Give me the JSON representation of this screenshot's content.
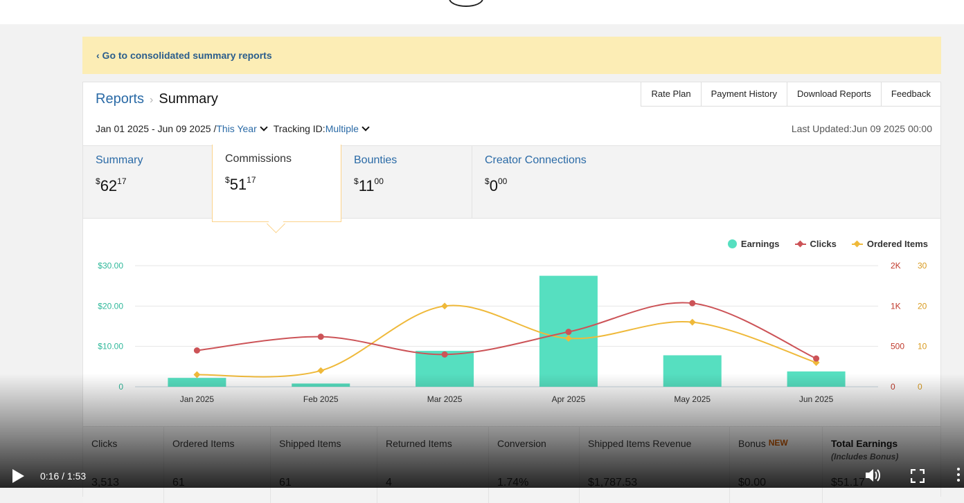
{
  "banner": {
    "link": "‹ Go to consolidated summary reports"
  },
  "breadcrumb": {
    "parent": "Reports",
    "separator": "›",
    "current": "Summary"
  },
  "toolbar": {
    "items": [
      "Rate Plan",
      "Payment History",
      "Download Reports",
      "Feedback"
    ]
  },
  "filters": {
    "date_range": "Jan 01 2025 - Jun 09 2025 /",
    "period": "This Year",
    "tracking_label": "Tracking ID:",
    "tracking_value": "Multiple",
    "last_updated": "Last Updated:Jun 09 2025 00:00"
  },
  "tabs": [
    {
      "label": "Summary",
      "currency": "$",
      "whole": "62",
      "cents": "17",
      "active": false
    },
    {
      "label": "Commissions",
      "currency": "$",
      "whole": "51",
      "cents": "17",
      "active": true
    },
    {
      "label": "Bounties",
      "currency": "$",
      "whole": "11",
      "cents": "00",
      "active": false
    },
    {
      "label": "Creator Connections",
      "currency": "$",
      "whole": "0",
      "cents": "00",
      "active": false
    }
  ],
  "legend": [
    "Earnings",
    "Clicks",
    "Ordered Items"
  ],
  "colors": {
    "earnings": "#56dfc0",
    "clicks": "#cc5357",
    "ordered": "#efb93a",
    "earnings_axis": "#2fb89a",
    "clicks_axis": "#c0392b",
    "ordered_axis": "#d89a1e"
  },
  "chart_data": {
    "type": "bar",
    "categories": [
      "Jan 2025",
      "Feb 2025",
      "Mar 2025",
      "Apr 2025",
      "May 2025",
      "Jun 2025"
    ],
    "series": [
      {
        "name": "Earnings",
        "type": "bar",
        "axis": "left",
        "values": [
          2.2,
          0.8,
          8.9,
          27.5,
          7.8,
          3.8
        ]
      },
      {
        "name": "Clicks",
        "type": "line",
        "axis": "right1",
        "values": [
          450,
          620,
          400,
          680,
          1070,
          350
        ]
      },
      {
        "name": "Ordered Items",
        "type": "line",
        "axis": "right2",
        "values": [
          3,
          4,
          20,
          12,
          16,
          6
        ]
      }
    ],
    "axes": {
      "left": {
        "ticks": [
          "0",
          "$10.00",
          "$20.00",
          "$30.00"
        ],
        "ylim": [
          0,
          30
        ]
      },
      "right1": {
        "ticks": [
          "0",
          "500",
          "1K",
          "2K"
        ],
        "tick_values": [
          0,
          500,
          1000,
          2000
        ]
      },
      "right2": {
        "ticks": [
          "0",
          "10",
          "20",
          "30"
        ],
        "ylim": [
          0,
          30
        ]
      }
    },
    "grid": true,
    "legend_position": "top-right"
  },
  "stats": [
    {
      "label": "Clicks",
      "value": "3,513"
    },
    {
      "label": "Ordered Items",
      "value": "61"
    },
    {
      "label": "Shipped Items",
      "value": "61"
    },
    {
      "label": "Returned Items",
      "value": "4"
    },
    {
      "label": "Conversion",
      "value": "1.74%"
    },
    {
      "label": "Shipped Items Revenue",
      "value": "$1,787.53"
    },
    {
      "label": "Bonus",
      "badge": "NEW",
      "value": "$0.00"
    },
    {
      "label": "Total Earnings",
      "sublabel": "(Includes Bonus)",
      "value": "$51.17"
    }
  ],
  "video": {
    "time": "0:16 / 1:53"
  }
}
